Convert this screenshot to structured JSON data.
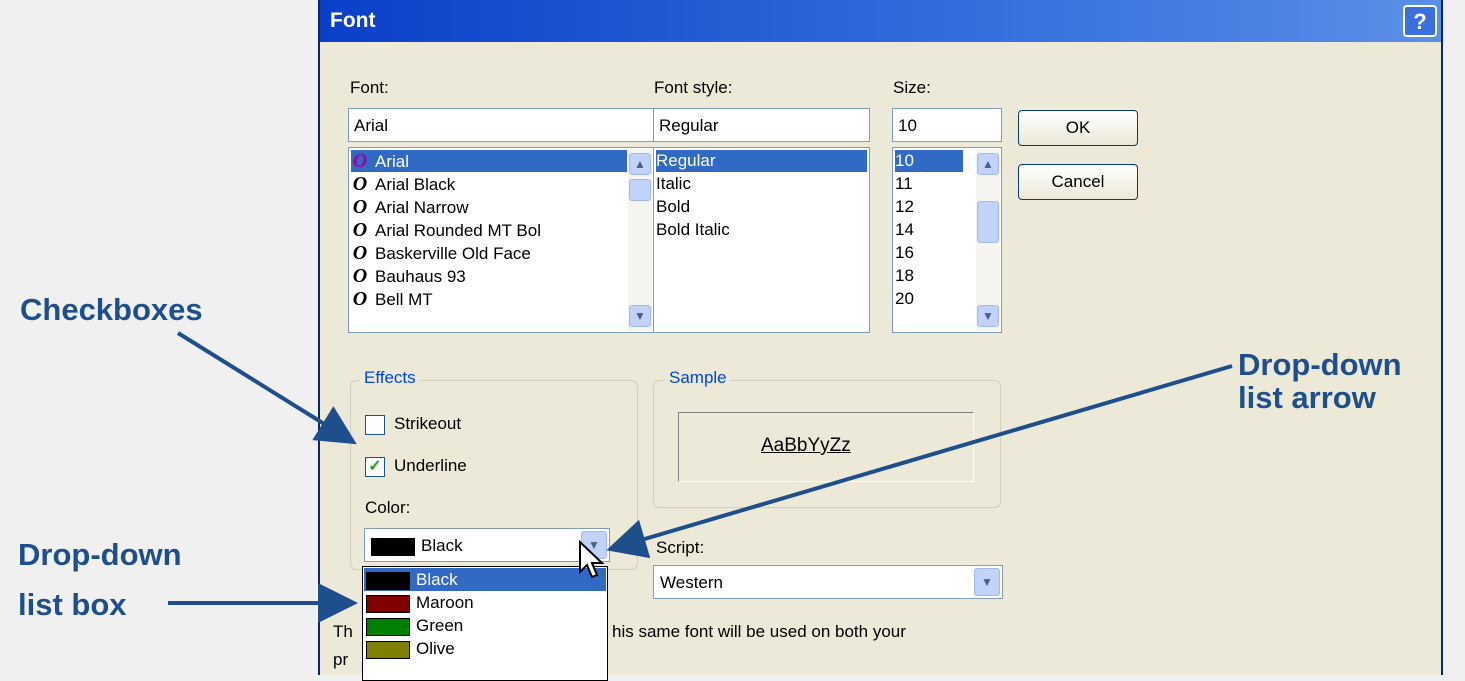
{
  "dialog": {
    "title": "Font",
    "help_label": "?",
    "font_label": "Font:",
    "font_value": "Arial",
    "font_list": [
      "Arial",
      "Arial Black",
      "Arial Narrow",
      "Arial Rounded MT Bol",
      "Baskerville Old Face",
      "Bauhaus 93",
      "Bell MT"
    ],
    "font_icon_glyph": "O",
    "style_label": "Font style:",
    "style_value": "Regular",
    "style_list": [
      "Regular",
      "Italic",
      "Bold",
      "Bold Italic"
    ],
    "size_label": "Size:",
    "size_value": "10",
    "size_list": [
      "10",
      "11",
      "12",
      "14",
      "16",
      "18",
      "20"
    ],
    "ok_label": "OK",
    "cancel_label": "Cancel",
    "effects_label": "Effects",
    "strikeout_label": "Strikeout",
    "underline_label": "Underline",
    "color_label": "Color:",
    "color_value": "Black",
    "color_options": [
      {
        "name": "Black",
        "hex": "#000000"
      },
      {
        "name": "Maroon",
        "hex": "#800000"
      },
      {
        "name": "Green",
        "hex": "#008000"
      },
      {
        "name": "Olive",
        "hex": "#808000"
      }
    ],
    "sample_label": "Sample",
    "sample_text": "AaBbYyZz",
    "script_label": "Script:",
    "script_value": "Western",
    "info_text_prefix": "Th",
    "info_text_visible": "his same font will be used on both your",
    "info_text_line2_prefix": "pr",
    "checkmark": "✓",
    "arrow_up": "▲",
    "arrow_down": "▼"
  },
  "callouts": {
    "checkboxes": "Checkboxes",
    "dropdown_arrow_line1": "Drop-down",
    "dropdown_arrow_line2": "list arrow",
    "dropdown_box_line1": "Drop-down",
    "dropdown_box_line2": "list box"
  },
  "colors": {
    "callout": "#1f4e8c",
    "selection": "#316ac5",
    "titlebar": "#0a3fc8",
    "dialog_bg": "#ece9d8"
  }
}
